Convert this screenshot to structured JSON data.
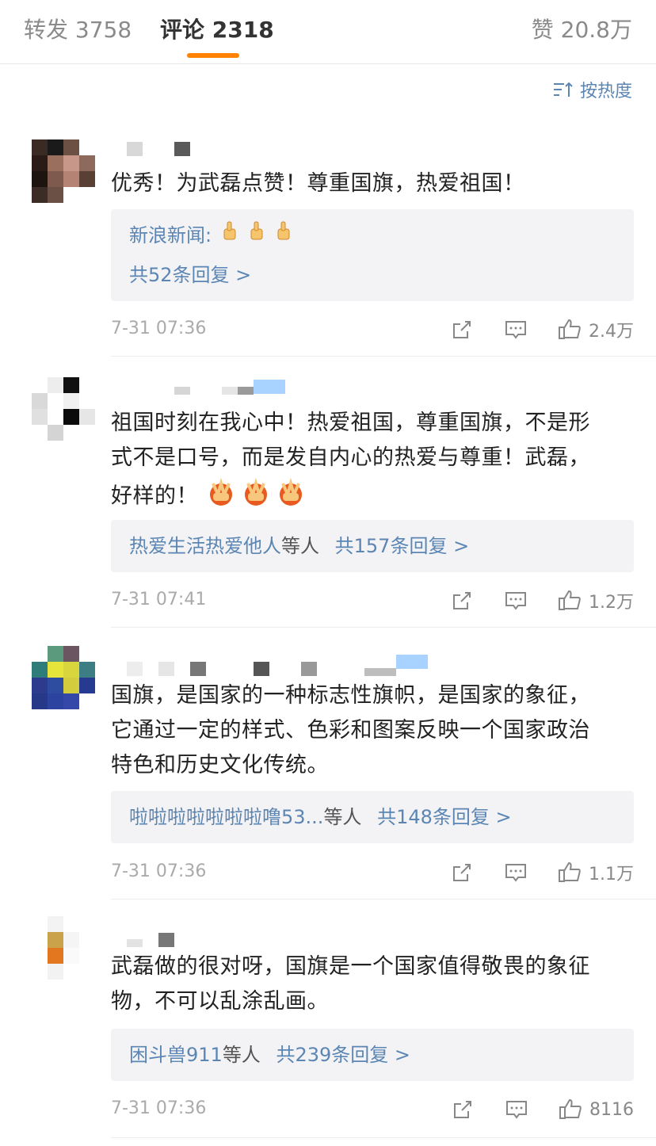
{
  "tabs": {
    "repost_label": "转发",
    "repost_count": "3758",
    "comment_label": "评论",
    "comment_count": "2318",
    "like_label": "赞",
    "like_count": "20.8万"
  },
  "sort": {
    "label": "按热度",
    "icon": "sort-icon"
  },
  "colors": {
    "accent": "#ff8200",
    "link": "#5b86b4",
    "reply_bg": "#f3f3f5"
  },
  "comments": [
    {
      "text": "优秀！为武磊点赞！尊重国旗，热爱祖国！",
      "reply_author": "新浪新闻:",
      "reply_emoji": "thumbs-up x3",
      "reply_count": "共52条回复 >",
      "time": "7-31 07:36",
      "likes": "2.4万"
    },
    {
      "text_lines": [
        "祖国时刻在我心中！热爱祖国，尊重国旗，不是形",
        "式不是口号，而是发自内心的热爱与尊重！武磊，",
        "好样的！"
      ],
      "text_emoji": "peace-sign x3",
      "reply_author": "热爱生活热爱他人",
      "reply_suffix": "等人",
      "reply_count": "共157条回复 >",
      "time": "7-31 07:41",
      "likes": "1.2万"
    },
    {
      "text_lines": [
        "国旗，是国家的一种标志性旗帜，是国家的象征，",
        "它通过一定的样式、色彩和图案反映一个国家政治",
        "特色和历史文化传统。"
      ],
      "reply_author": "啦啦啦啦啦啦啦噜53...",
      "reply_suffix": "等人",
      "reply_count": "共148条回复 >",
      "time": "7-31 07:36",
      "likes": "1.1万"
    },
    {
      "text_lines": [
        "武磊做的很对呀，国旗是一个国家值得敬畏的象征",
        "物，不可以乱涂乱画。"
      ],
      "reply_author": "困斗兽911",
      "reply_suffix": "等人",
      "reply_count": "共239条回复 >",
      "time": "7-31 07:36",
      "likes": "8116"
    }
  ]
}
